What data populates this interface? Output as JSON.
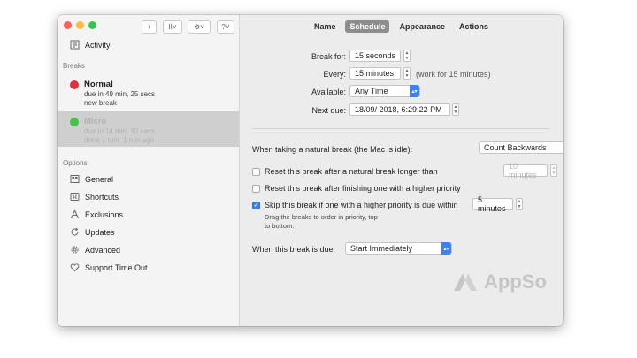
{
  "toolbar": {
    "add_glyph": "+",
    "pause_glyph": "II˅",
    "gear_glyph": "⚙˅",
    "help_glyph": "?˅"
  },
  "sidebar": {
    "activity": "Activity",
    "breaks_header": "Breaks",
    "breaks": [
      {
        "name": "Normal",
        "line1": "due in 49 min, 25 secs",
        "line2": "new break",
        "color": "#e0303a"
      },
      {
        "name": "Micro",
        "line1": "due in 14 min, 10 secs",
        "line2": "done 1 min, 1 min ago",
        "color": "#44c24a"
      }
    ],
    "options_header": "Options",
    "options": [
      "General",
      "Shortcuts",
      "Exclusions",
      "Updates",
      "Advanced",
      "Support Time Out"
    ]
  },
  "tabs": [
    "Name",
    "Schedule",
    "Appearance",
    "Actions"
  ],
  "active_tab": "Schedule",
  "schedule": {
    "break_for_label": "Break for:",
    "break_for_value": "15 seconds",
    "every_label": "Every:",
    "every_value": "15 minutes",
    "every_note": "(work for 15 minutes)",
    "available_label": "Available:",
    "available_value": "Any Time",
    "next_due_label": "Next due:",
    "next_due_value": "18/09/ 2018,  6:29:22 PM"
  },
  "natural": {
    "label": "When taking a natural break (the Mac is idle):",
    "value": "Count Backwards"
  },
  "options": {
    "reset_natural": "Reset this break after a natural break longer than",
    "reset_natural_value": "10 minutes",
    "reset_natural_checked": false,
    "reset_priority": "Reset this break after finishing one with a higher priority",
    "reset_priority_checked": false,
    "skip_label": "Skip this break if one with a higher priority is due within",
    "skip_value": "5 minutes",
    "skip_checked": true,
    "skip_hint_1": "Drag the breaks to order in priority, top",
    "skip_hint_2": "to bottom."
  },
  "when_due": {
    "label": "When this break is due:",
    "value": "Start Immediately"
  },
  "watermark": "AppSo",
  "colors": {
    "accent": "#3b82f6",
    "close": "#fc605c",
    "minimize": "#fdbc40",
    "zoom": "#34c84a",
    "selected_row": "#cfcfcf"
  }
}
